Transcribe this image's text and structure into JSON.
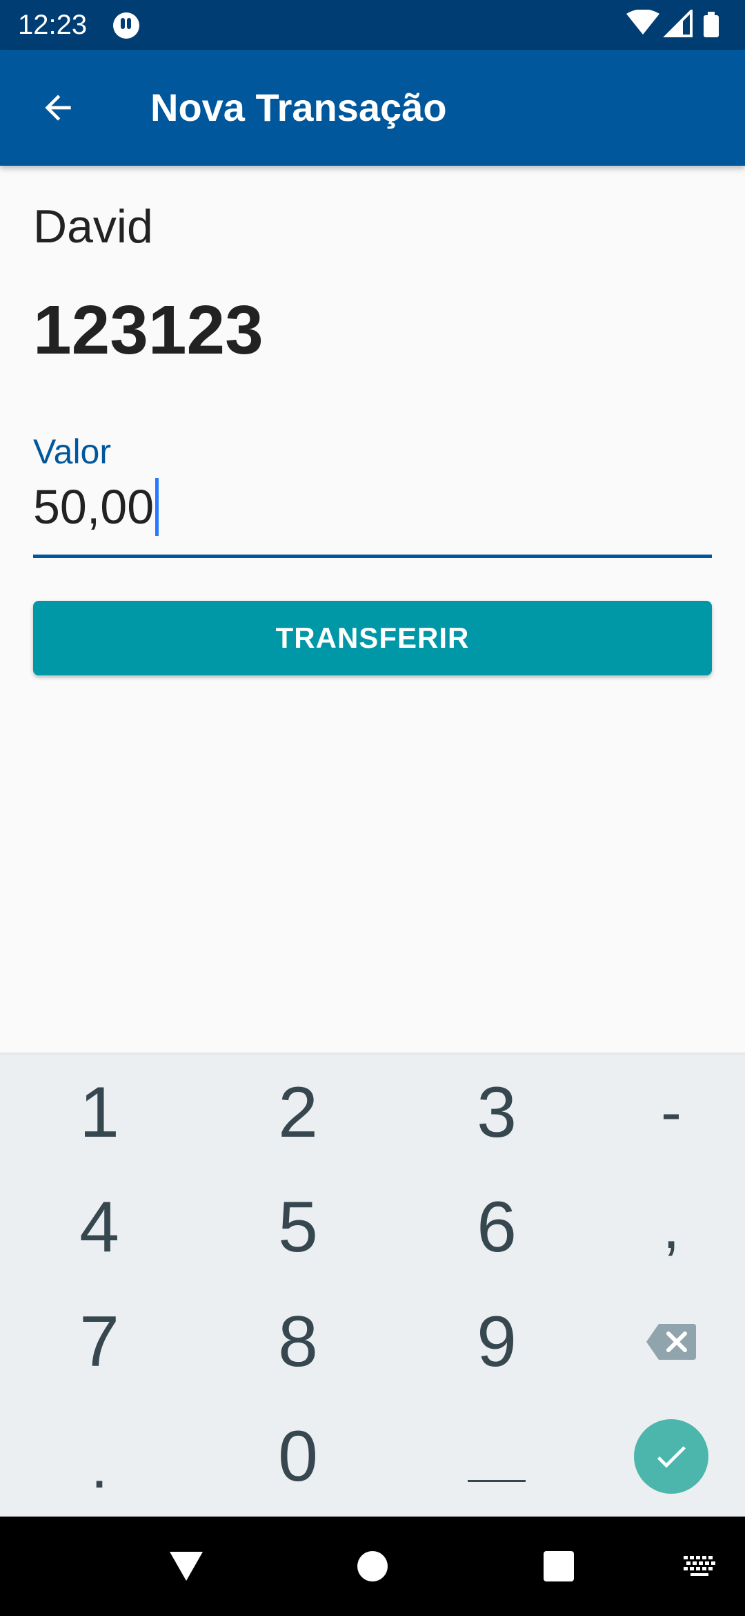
{
  "status_bar": {
    "time": "12:23"
  },
  "app_bar": {
    "title": "Nova Transação"
  },
  "contact": {
    "name": "David",
    "account": "123123"
  },
  "amount_field": {
    "label": "Valor",
    "value": "50,00"
  },
  "transfer_button": {
    "label": "TRANSFERIR"
  },
  "keyboard": {
    "rows": [
      [
        "1",
        "2",
        "3",
        "-"
      ],
      [
        "4",
        "5",
        "6",
        ","
      ],
      [
        "7",
        "8",
        "9",
        "backspace-icon"
      ],
      [
        ".",
        "0",
        "_",
        "check-icon"
      ]
    ]
  },
  "colors": {
    "primary_dark": "#003d72",
    "primary": "#01579b",
    "button": "#0098a7",
    "keyboard_bg": "#eceff1",
    "confirm_key": "#4db6ac"
  }
}
